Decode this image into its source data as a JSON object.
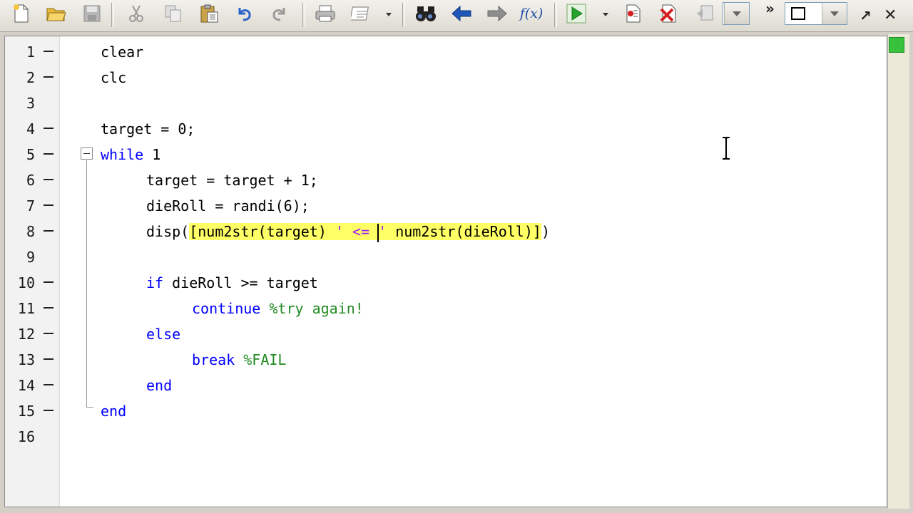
{
  "toolbar": {
    "buttons": [
      {
        "name": "new-file",
        "icon": "new-file-icon"
      },
      {
        "name": "open-file",
        "icon": "folder-open-icon"
      },
      {
        "name": "save",
        "icon": "save-icon"
      },
      {
        "name": "cut",
        "icon": "scissors-icon"
      },
      {
        "name": "copy",
        "icon": "copy-icon"
      },
      {
        "name": "paste",
        "icon": "paste-icon"
      },
      {
        "name": "undo",
        "icon": "undo-icon"
      },
      {
        "name": "redo",
        "icon": "redo-icon"
      },
      {
        "name": "print",
        "icon": "printer-icon"
      },
      {
        "name": "publish",
        "icon": "publish-icon"
      },
      {
        "name": "find",
        "icon": "binoculars-icon"
      },
      {
        "name": "back",
        "icon": "arrow-left-icon"
      },
      {
        "name": "forward",
        "icon": "arrow-right-icon"
      },
      {
        "name": "function-browser",
        "icon": "fx-icon"
      },
      {
        "name": "run",
        "icon": "run-icon"
      },
      {
        "name": "set-breakpoint",
        "icon": "breakpoint-icon"
      },
      {
        "name": "clear-breakpoints",
        "icon": "clear-breakpoints-icon"
      },
      {
        "name": "stack",
        "icon": "stack-icon"
      }
    ],
    "fx_label": "f(x)",
    "overflow_label": "»",
    "close_label": "✕",
    "undock_label": "↗"
  },
  "editor": {
    "line_numbers": [
      "1",
      "2",
      "3",
      "4",
      "5",
      "6",
      "7",
      "8",
      "9",
      "10",
      "11",
      "12",
      "13",
      "14",
      "15",
      "16"
    ],
    "lines": {
      "l1": "clear",
      "l2": "clc",
      "l4": "target = 0;",
      "l5_kw": "while",
      "l5_rest": " 1",
      "l6": "target = target + 1;",
      "l7": "dieRoll = randi(6);",
      "l8_a": "disp(",
      "l8_b": "[num2str(target) ",
      "l8_str1": "' <= ",
      "l8_str2": "'",
      "l8_c": " num2str(dieRoll)]",
      "l8_d": ")",
      "l10_kw": "if",
      "l10_rest": " dieRoll >= target",
      "l11_kw": "continue",
      "l11_cm": "%try again!",
      "l12_kw": "else",
      "l13_kw": "break",
      "l13_cm": "%FAIL",
      "l14_kw": "end",
      "l15_kw": "end"
    }
  },
  "colors": {
    "keyword": "#0000ff",
    "comment": "#228b22",
    "string": "#a020f0",
    "highlight": "#ffff66",
    "status_ok": "#36c23a"
  }
}
